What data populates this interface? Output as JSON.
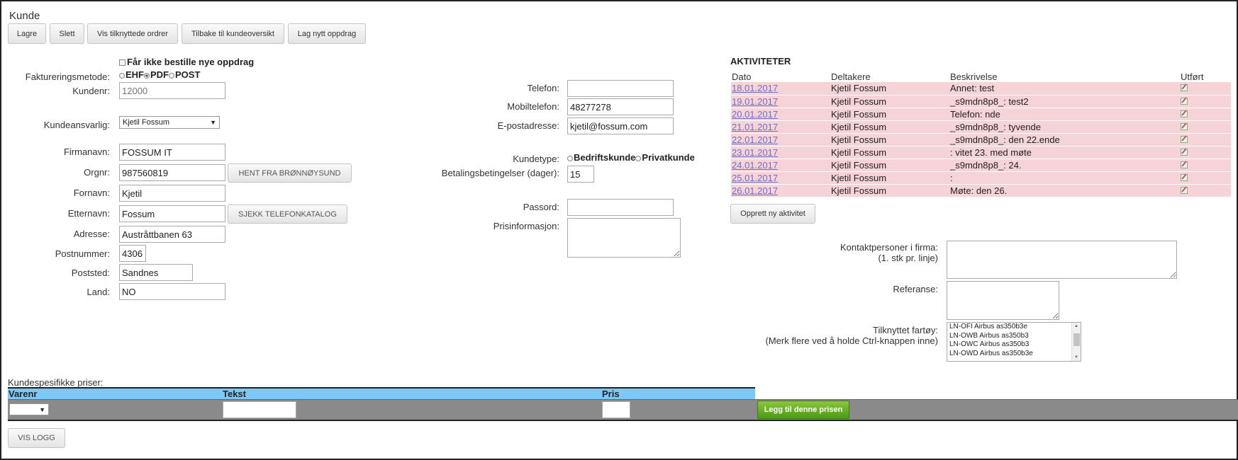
{
  "page": {
    "title": "Kunde"
  },
  "toolbar": {
    "save": "Lagre",
    "delete": "Slett",
    "show_orders": "Vis tilknyttede ordrer",
    "back": "Tilbake til kundeoversikt",
    "new_order": "Lag nytt oppdrag"
  },
  "customer": {
    "block_orders_label": "Får ikke bestille nye oppdrag",
    "billing_method_label": "Faktureringsmetode:",
    "billing_options": [
      "EHF",
      "PDF",
      "POST"
    ],
    "billing_selected": "PDF",
    "customer_no_label": "Kundenr:",
    "customer_no": "12000",
    "responsible_label": "Kundeansvarlig:",
    "responsible": "Kjetil Fossum",
    "company_label": "Firmanavn:",
    "company": "FOSSUM IT",
    "orgno_label": "Orgnr:",
    "orgno": "987560819",
    "bronnoysund_button": "HENT FRA BRØNNØYSUND",
    "firstname_label": "Fornavn:",
    "firstname": "Kjetil",
    "lastname_label": "Etternavn:",
    "lastname": "Fossum",
    "phonebook_button": "SJEKK TELEFONKATALOG",
    "address_label": "Adresse:",
    "address": "Austråttbanen 63",
    "postcode_label": "Postnummer:",
    "postcode": "4306",
    "city_label": "Poststed:",
    "city": "Sandnes",
    "country_label": "Land:",
    "country": "NO"
  },
  "contact": {
    "phone_label": "Telefon:",
    "phone": "",
    "mobile_label": "Mobiltelefon:",
    "mobile": "48277278",
    "email_label": "E-postadresse:",
    "email": "kjetil@fossum.com",
    "customer_type_label": "Kundetype:",
    "customer_types": [
      "Bedriftskunde",
      "Privatkunde"
    ],
    "payment_terms_label": "Betalingsbetingelser (dager):",
    "payment_terms": "15",
    "password_label": "Passord:",
    "price_info_label": "Prisinformasjon:"
  },
  "activities": {
    "title": "AKTIVITETER",
    "columns": [
      "Dato",
      "Deltakere",
      "Beskrivelse",
      "Utført"
    ],
    "rows": [
      {
        "date": "18.01.2017",
        "participant": "Kjetil Fossum",
        "description": "Annet: test"
      },
      {
        "date": "19.01.2017",
        "participant": "Kjetil Fossum",
        "description": "_s9mdn8p8_: test2"
      },
      {
        "date": "20.01.2017",
        "participant": "Kjetil Fossum",
        "description": "Telefon: nde"
      },
      {
        "date": "21.01.2017",
        "participant": "Kjetil Fossum",
        "description": "_s9mdn8p8_: tyvende"
      },
      {
        "date": "22.01.2017",
        "participant": "Kjetil Fossum",
        "description": "_s9mdn8p8_: den 22.ende"
      },
      {
        "date": "23.01.2017",
        "participant": "Kjetil Fossum",
        "description": ": vitet 23. med møte"
      },
      {
        "date": "24.01.2017",
        "participant": "Kjetil Fossum",
        "description": "_s9mdn8p8_: 24."
      },
      {
        "date": "25.01.2017",
        "participant": "Kjetil Fossum",
        "description": ":"
      },
      {
        "date": "26.01.2017",
        "participant": "Kjetil Fossum",
        "description": "Møte: den 26."
      }
    ],
    "new_button": "Opprett ny aktivitet"
  },
  "extra": {
    "contacts_label_1": "Kontaktpersoner i firma:",
    "contacts_label_2": "(1. stk pr. linje)",
    "reference_label": "Referanse:",
    "vessel_label_1": "Tilknyttet fartøy:",
    "vessel_label_2": "(Merk flere ved å holde Ctrl-knappen inne)",
    "vessels": [
      "LN-OFI Airbus as350b3e",
      "LN-OWB Airbus as350b3",
      "LN-OWC Airbus as350b3",
      "LN-OWD Airbus as350b3e"
    ]
  },
  "prices": {
    "title": "Kundespesifikke priser:",
    "col_item": "Varenr",
    "col_text": "Tekst",
    "col_price": "Pris",
    "add_button": "Legg til denne prisen"
  },
  "footer": {
    "log_button": "VIS LOGG"
  }
}
